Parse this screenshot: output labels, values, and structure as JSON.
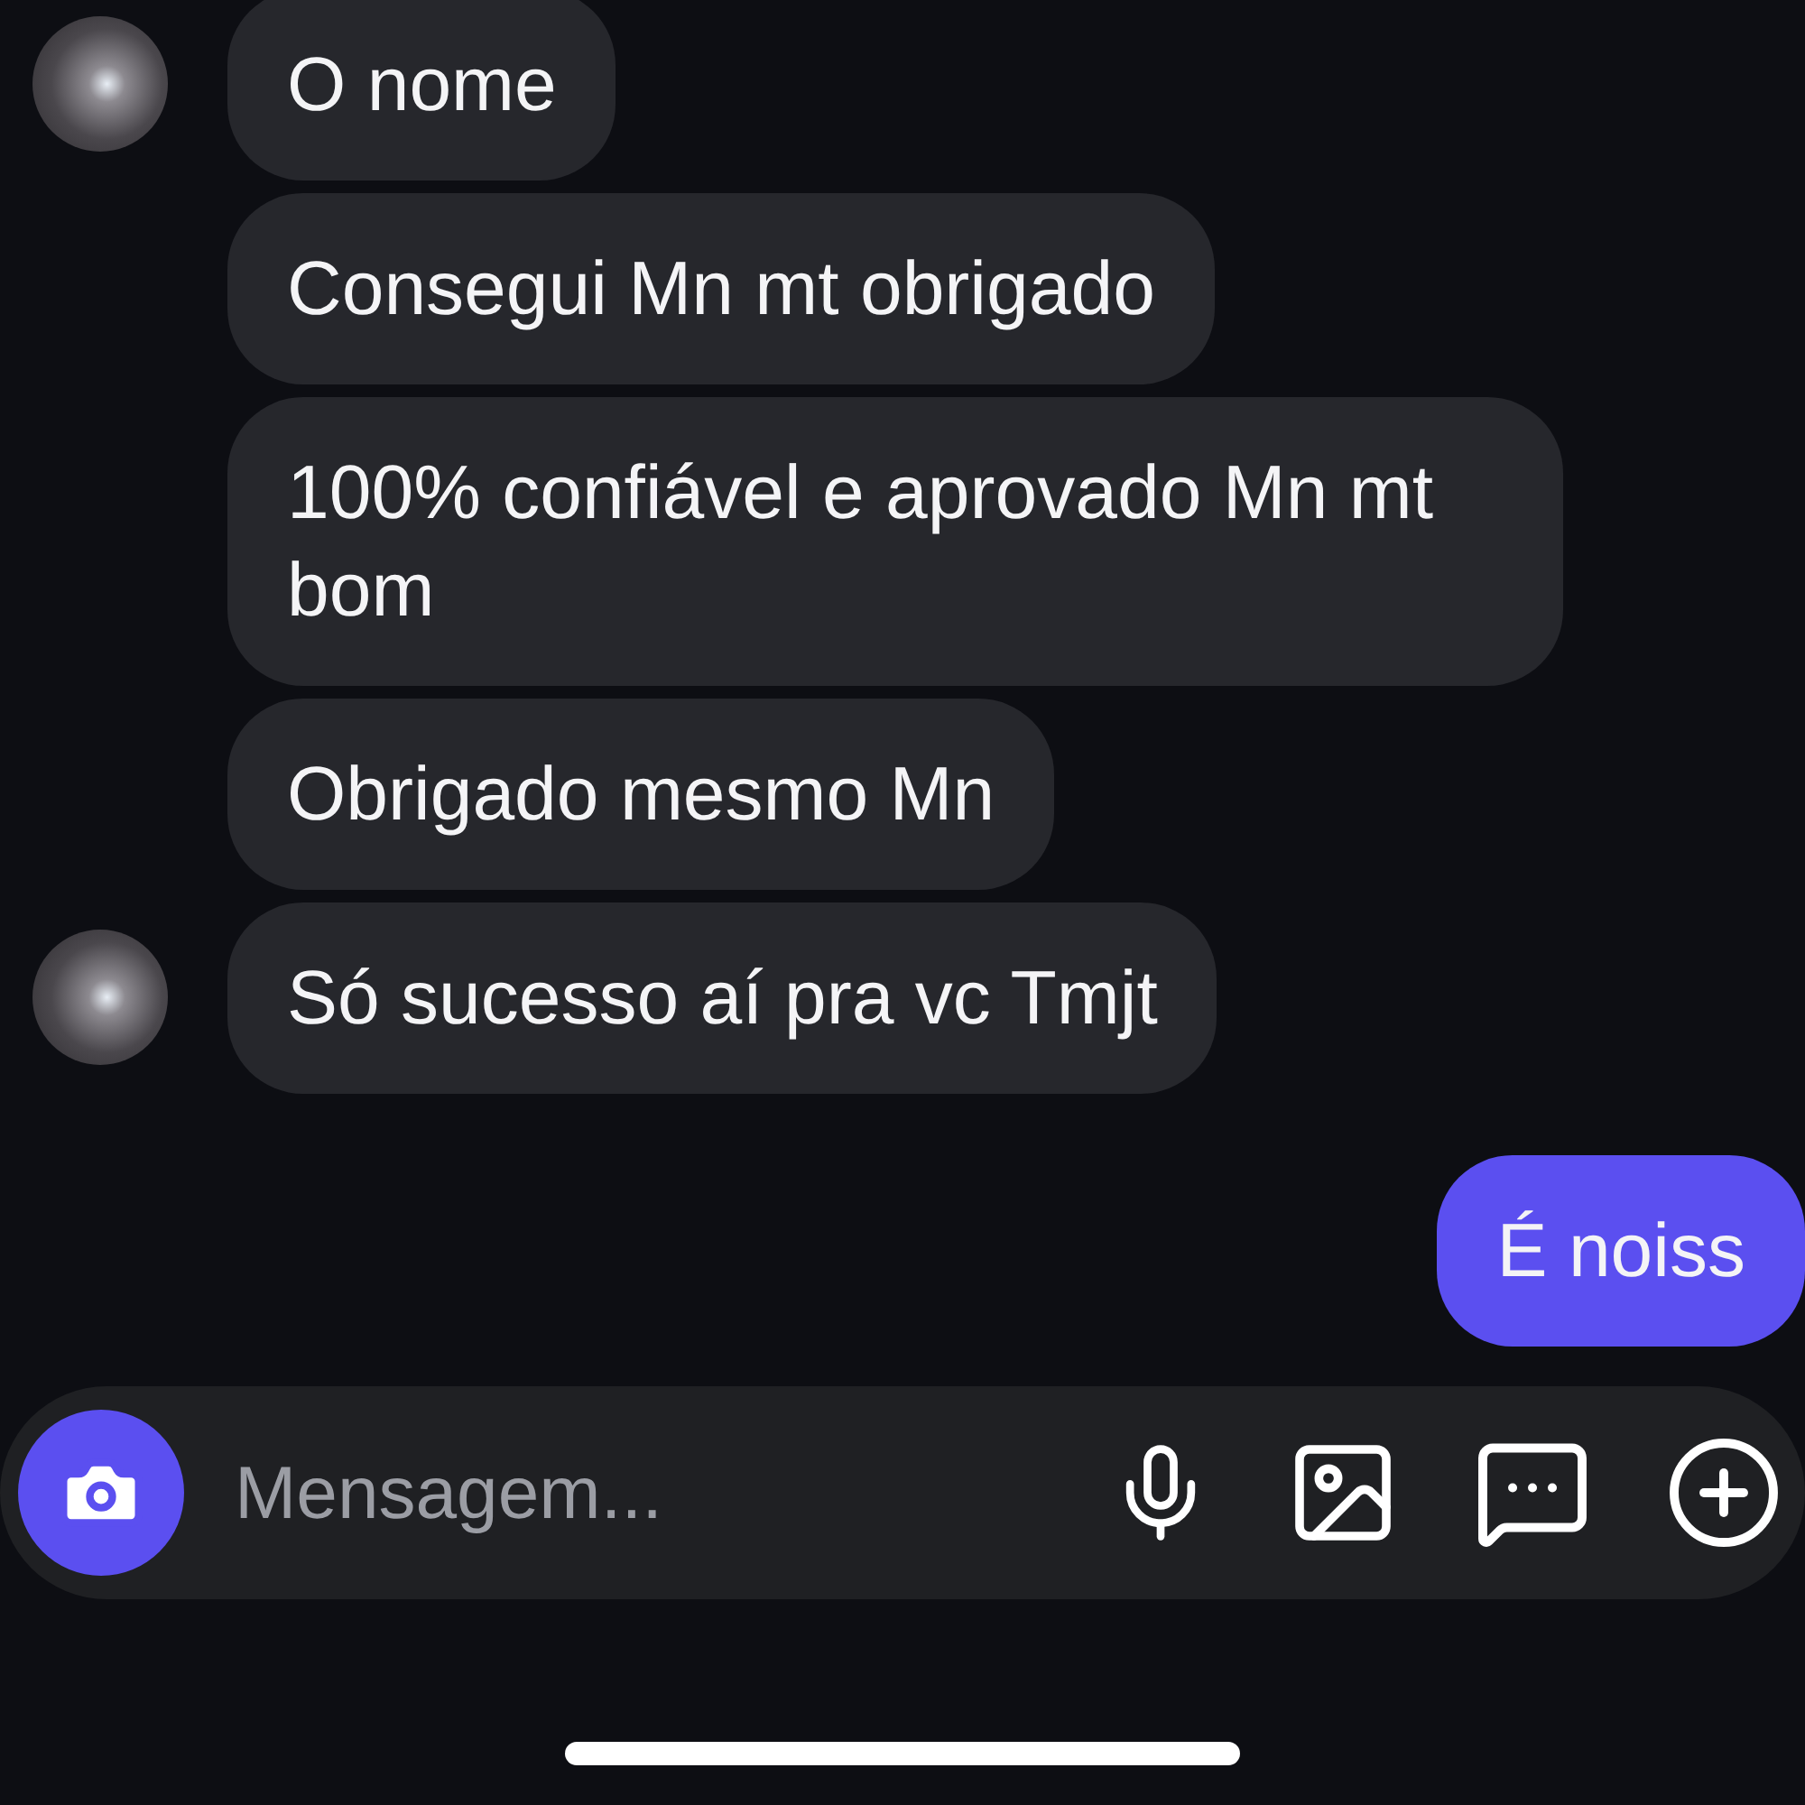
{
  "messages": [
    {
      "kind": "received",
      "text": "O nome",
      "avatar": true
    },
    {
      "kind": "received",
      "text": "Consegui Mn mt obrigado",
      "avatar": false
    },
    {
      "kind": "received",
      "text": "100% confiável e aprovado Mn mt bom",
      "avatar": false
    },
    {
      "kind": "received",
      "text": "Obrigado mesmo Mn",
      "avatar": false
    },
    {
      "kind": "received",
      "text": "Só sucesso aí pra vc Tmjt",
      "avatar": true
    },
    {
      "kind": "sent",
      "text": "É noiss",
      "avatar": false
    }
  ],
  "composer": {
    "placeholder": "Mensagem..."
  }
}
